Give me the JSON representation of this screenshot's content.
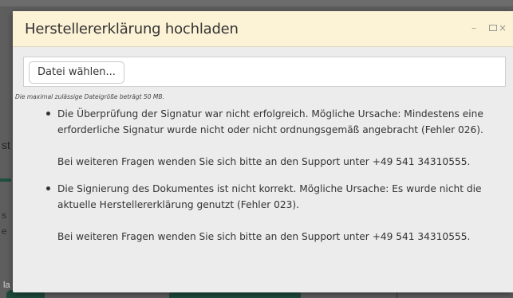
{
  "background": {
    "fragments": {
      "st": "st",
      "s": "s",
      "e": "e",
      "la": "la"
    }
  },
  "dialog": {
    "title": "Herstellererklärung hochladen",
    "controls": {
      "minimize": "–",
      "close": "×"
    },
    "file_button_label": "Datei wählen...",
    "size_hint": "Die maximal zulässige Dateigröße beträgt 50 MB.",
    "errors": [
      {
        "message": "Die Überprüfung der Signatur war nicht erfolgreich. Mögliche Ursache: Mindestens eine erforderliche Signatur wurde nicht oder nicht ordnungsgemäß angebracht (Fehler 026).",
        "support": "Bei weiteren Fragen wenden Sie sich bitte an den Support unter +49 541 34310555."
      },
      {
        "message": "Die Signierung des Dokumentes ist nicht korrekt. Mögliche Ursache: Es wurde nicht die aktuelle Herstellererklärung genutzt (Fehler 023).",
        "support": "Bei weiteren Fragen wenden Sie sich bitte an den Support unter +49 541 34310555."
      }
    ]
  },
  "colors": {
    "titlebar_bg": "#fcf2d6",
    "dialog_bg": "#ececec",
    "overlay": "#5e5e5e",
    "accent_green": "#1e4a3a"
  }
}
